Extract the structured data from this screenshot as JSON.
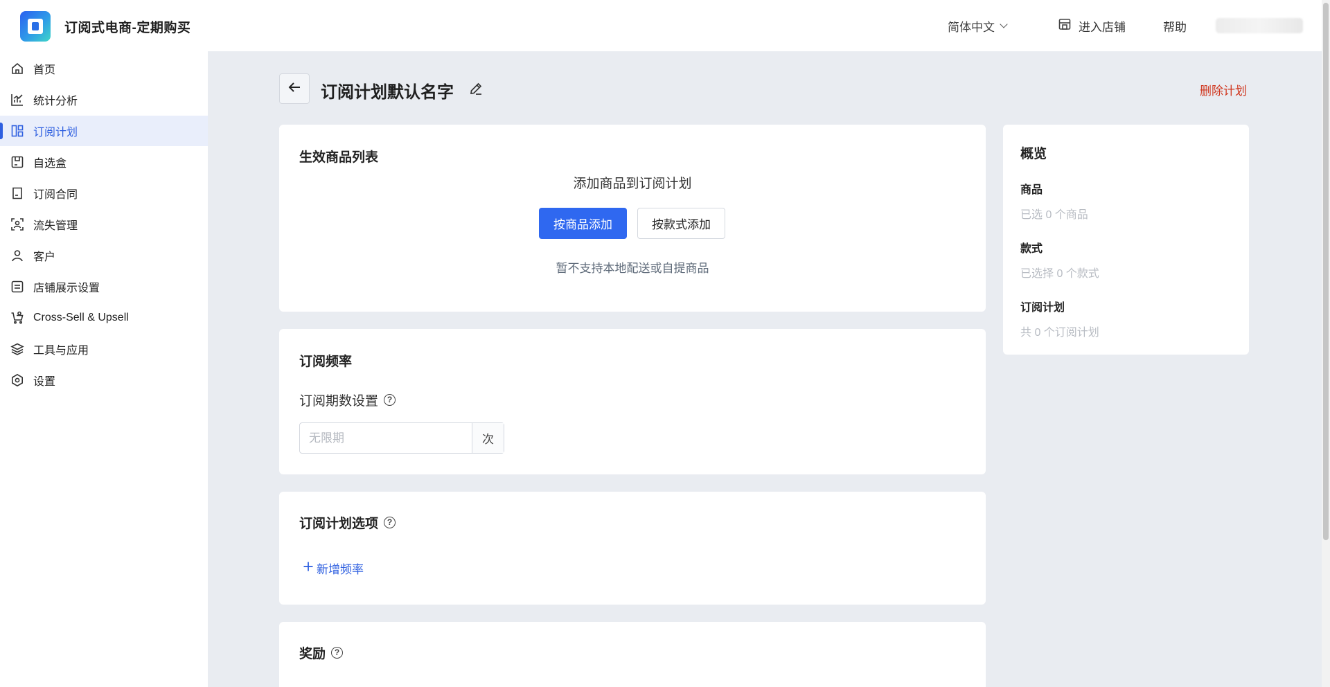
{
  "header": {
    "app_title": "订阅式电商-定期购买",
    "language": "简体中文",
    "store_link": "进入店铺",
    "help": "帮助"
  },
  "sidebar": {
    "items": [
      {
        "label": "首页",
        "icon": "home-icon"
      },
      {
        "label": "统计分析",
        "icon": "chart-icon"
      },
      {
        "label": "订阅计划",
        "icon": "layout-icon",
        "active": true
      },
      {
        "label": "自选盒",
        "icon": "box-icon"
      },
      {
        "label": "订阅合同",
        "icon": "document-icon"
      },
      {
        "label": "流失管理",
        "icon": "user-frame-icon"
      },
      {
        "label": "客户",
        "icon": "person-icon"
      },
      {
        "label": "店铺展示设置",
        "icon": "list-icon"
      },
      {
        "label": "Cross-Sell & Upsell",
        "icon": "cart-icon"
      },
      {
        "label": "工具与应用",
        "icon": "layers-icon"
      },
      {
        "label": "设置",
        "icon": "hexagon-gear-icon"
      }
    ]
  },
  "page": {
    "title": "订阅计划默认名字",
    "delete_label": "删除计划"
  },
  "products_card": {
    "title": "生效商品列表",
    "add_heading": "添加商品到订阅计划",
    "add_by_product": "按商品添加",
    "add_by_variant": "按款式添加",
    "note": "暂不支持本地配送或自提商品"
  },
  "frequency_card": {
    "title": "订阅频率",
    "period_label": "订阅期数设置",
    "period_placeholder": "无限期",
    "period_suffix": "次"
  },
  "options_card": {
    "title": "订阅计划选项",
    "add_frequency": "新增频率"
  },
  "rewards_card": {
    "title": "奖励"
  },
  "overview": {
    "title": "概览",
    "products_label": "商品",
    "products_value": "已选 0 个商品",
    "variants_label": "款式",
    "variants_value": "已选择 0 个款式",
    "plans_label": "订阅计划",
    "plans_value": "共 0 个订阅计划"
  },
  "colors": {
    "accent": "#2f68f0",
    "danger": "#d0361e",
    "background": "#e9ecf1"
  }
}
